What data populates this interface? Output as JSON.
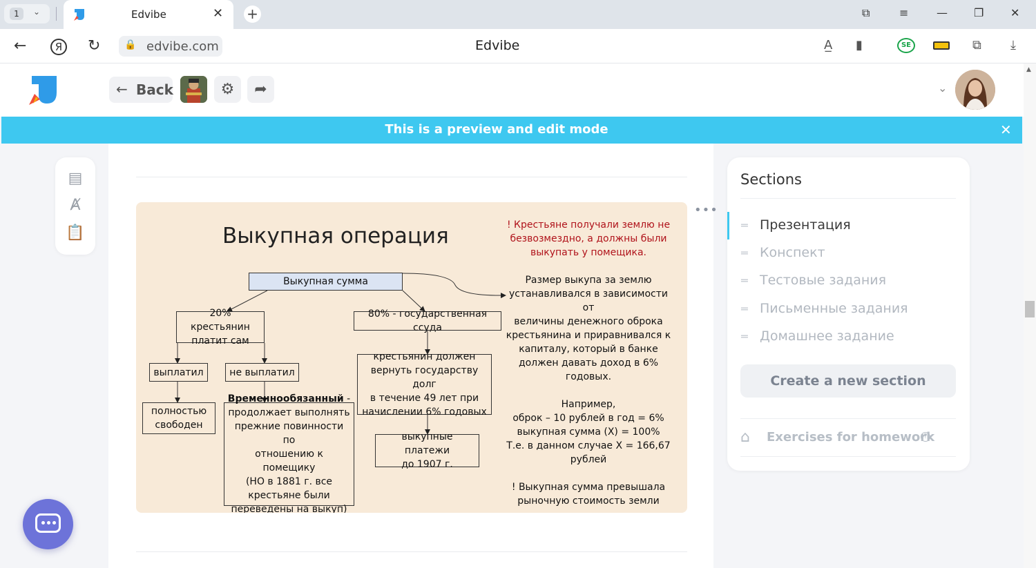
{
  "browser": {
    "tab_count": "1",
    "tab_title": "Edvibe",
    "url": "edvibe.com",
    "page_title": "Edvibe"
  },
  "header": {
    "back_label": "Back"
  },
  "banner": {
    "message": "This is a preview and edit mode"
  },
  "slide": {
    "title": "Выкупная операция",
    "root_box": "Выкупная сумма",
    "left_box": [
      "20% крестьянин",
      "платит сам"
    ],
    "paid": "выплатил",
    "not_paid": "не выплатил",
    "free": [
      "полностью",
      "свободен"
    ],
    "temp_bold": "Временнообязанный",
    "temp_lines": [
      "продолжает выполнять",
      "прежние повинности по",
      "отношению к помещику",
      "(НО в 1881 г. все",
      "крестьяне были",
      "переведены на выкуп)"
    ],
    "right_box": "80% - государственная ссуда",
    "loan_lines": [
      "крестьянин должен",
      "вернуть государству долг",
      "в течение 49 лет при",
      "начислении 6% годовых"
    ],
    "payments": [
      "выкупные платежи",
      "до 1907 г."
    ],
    "red_note": [
      "! Крестьяне получали землю не",
      "безвозмездно, а должны были",
      "выкупать у помещика."
    ],
    "explanation": [
      "Размер выкупа за землю",
      "устанавливался в зависимости от",
      "величины денежного оброка",
      "крестьянина и приравнивался к",
      "капиталу, который в банке",
      "должен давать доход в 6%",
      "годовых.",
      "",
      "Например,",
      "оброк – 10 рублей в год = 6%",
      "выкупная сумма (Х) = 100%",
      "Т.е. в данном случае Х = 166,67",
      "рублей",
      "",
      "! Выкупная сумма превышала",
      "рыночную стоимость земли"
    ]
  },
  "sections": {
    "header": "Sections",
    "items": [
      {
        "label": "Презентация",
        "active": true
      },
      {
        "label": "Конспект",
        "active": false
      },
      {
        "label": "Тестовые задания",
        "active": false
      },
      {
        "label": "Письменные задания",
        "active": false
      },
      {
        "label": "Домашнее задание",
        "active": false
      }
    ],
    "create_label": "Create a new section",
    "homework_label": "Exercises for homework"
  },
  "colors": {
    "accent": "#3ec8f0",
    "slide_bg": "#f8ead8",
    "red_text": "#b0131b",
    "chat_button": "#6d73d9"
  }
}
